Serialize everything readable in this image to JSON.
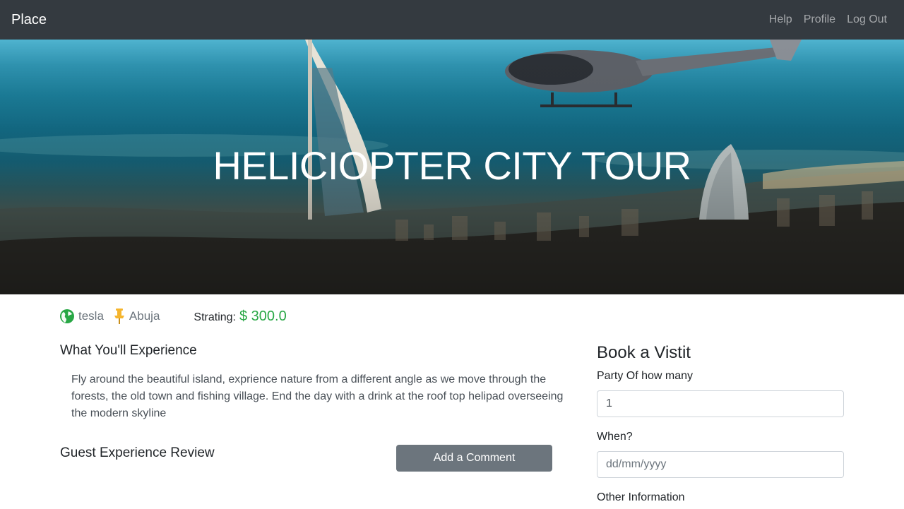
{
  "navbar": {
    "brand": "Place",
    "links": [
      "Help",
      "Profile",
      "Log Out"
    ]
  },
  "hero": {
    "title": "HELICIOPTER CITY TOUR"
  },
  "meta": {
    "host": "tesla",
    "location": "Abuja",
    "rating_label": "Strating:",
    "price": "$ 300.0",
    "icons": {
      "host": "globe-icon",
      "location": "pushpin-icon"
    },
    "colors": {
      "globe": "#28a745",
      "pin": "#f5b52e",
      "price": "#28a745"
    }
  },
  "experience": {
    "heading": "What You'll Experience",
    "description": "Fly around the beautiful island, exprience nature from a different angle as we move through the forests, the old town and fishing village. End the day with a drink at the roof top helipad overseeing the modern skyline"
  },
  "reviews": {
    "heading": "Guest Experience Review",
    "add_comment_label": "Add a Comment"
  },
  "booking": {
    "title": "Book a Vistit",
    "party_label": "Party Of how many",
    "party_value": "1",
    "when_label": "When?",
    "when_placeholder": "dd/mm/yyyy",
    "other_label": "Other Information"
  }
}
